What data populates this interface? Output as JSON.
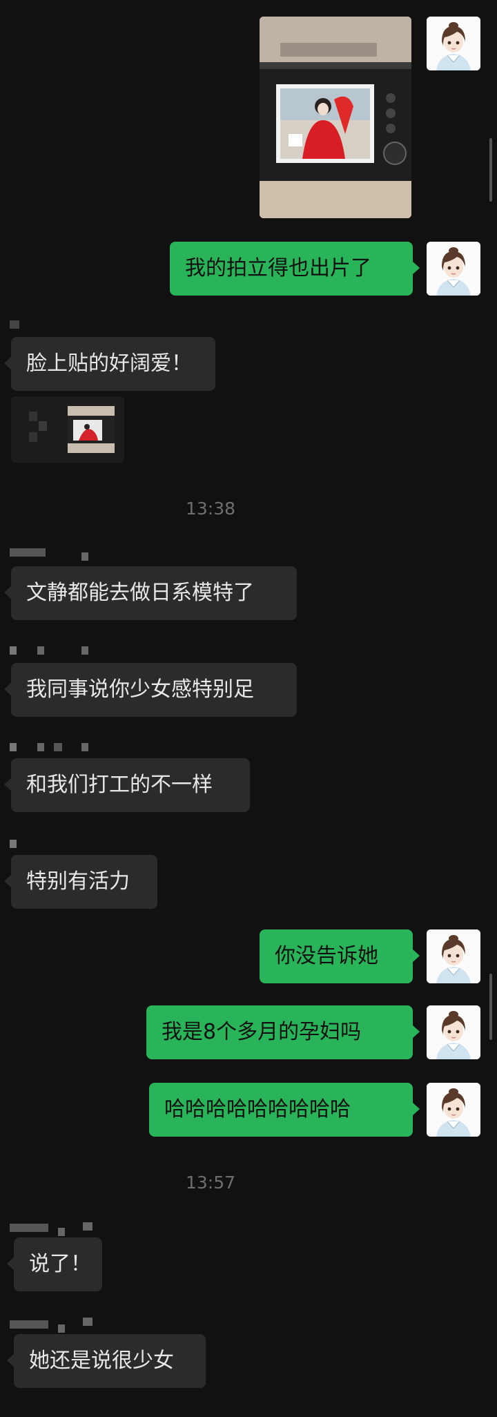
{
  "messages": {
    "m1_out": "我的拍立得也出片了",
    "m2_in": "脸上贴的好阔爱！",
    "time1": "13:38",
    "m3_in": "文静都能去做日系模特了",
    "m4_in": "我同事说你少女感特别足",
    "m5_in": "和我们打工的不一样",
    "m6_in": "特别有活力",
    "m7_out": "你没告诉她",
    "m8_out": "我是8个多月的孕妇吗",
    "m9_out": "哈哈哈哈哈哈哈哈哈",
    "time2": "13:57",
    "m10_in": "说了！",
    "m11_in": "她还是说很少女"
  },
  "icons": {
    "avatar": "user-avatar-icon",
    "photo": "camera-photo-thumbnail",
    "quote": "quoted-photo-thumbnail"
  },
  "colors": {
    "background": "#111111",
    "outgoing_bubble": "#29b45a",
    "incoming_bubble": "#2b2b2b"
  }
}
